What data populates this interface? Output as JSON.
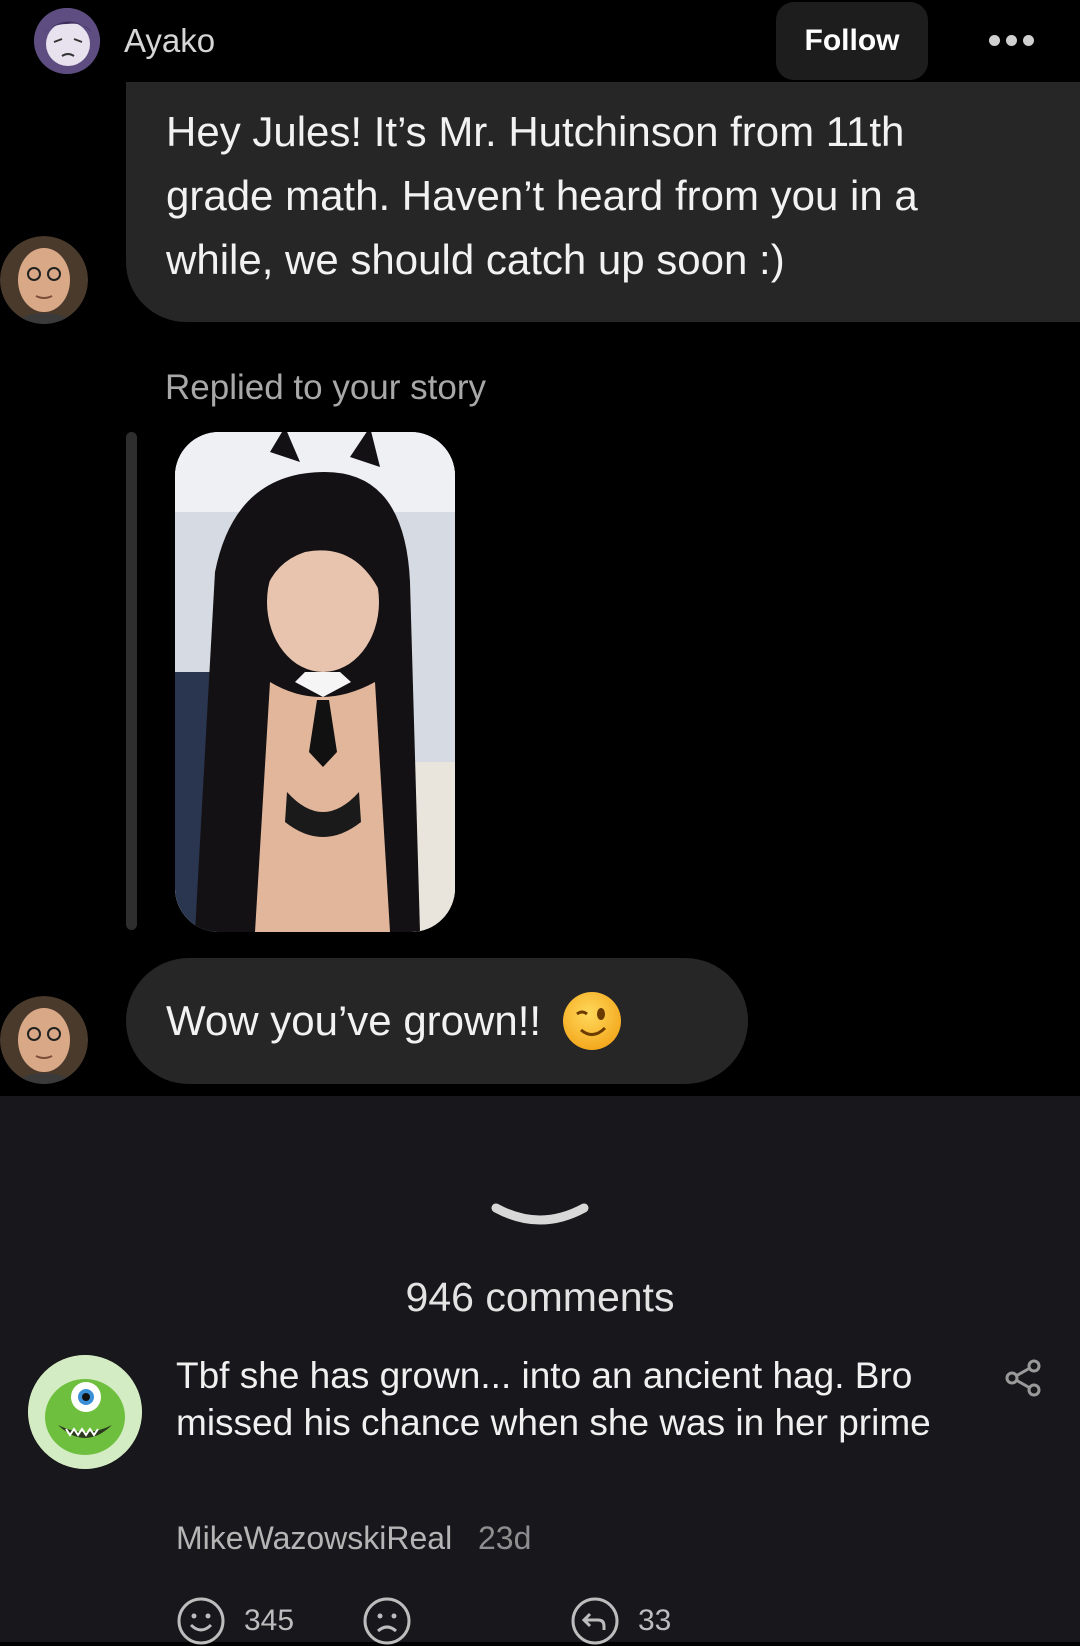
{
  "header": {
    "username": "Ayako",
    "follow_label": "Follow",
    "more_icon": "more-dots-icon"
  },
  "chat": {
    "message_1": "Hey Jules! It’s Mr. Hutchinson from 11th\ngrade math. Haven’t heard from you in a\nwhile, we should catch up soon :)",
    "replied_label": "Replied to your story",
    "message_2": "Wow you’ve grown!!",
    "message_2_emoji": "winking-face-emoji"
  },
  "comments": {
    "count_label": "946 comments",
    "items": [
      {
        "text": "Tbf she has grown... into an ancient hag. Bro missed his chance when she was in her prime",
        "author": "MikeWazowskiReal",
        "time": "23d",
        "upvotes": "345",
        "replies": "33"
      }
    ]
  },
  "colors": {
    "background": "#000000",
    "bubble": "#262626",
    "panel": "#17171c"
  }
}
